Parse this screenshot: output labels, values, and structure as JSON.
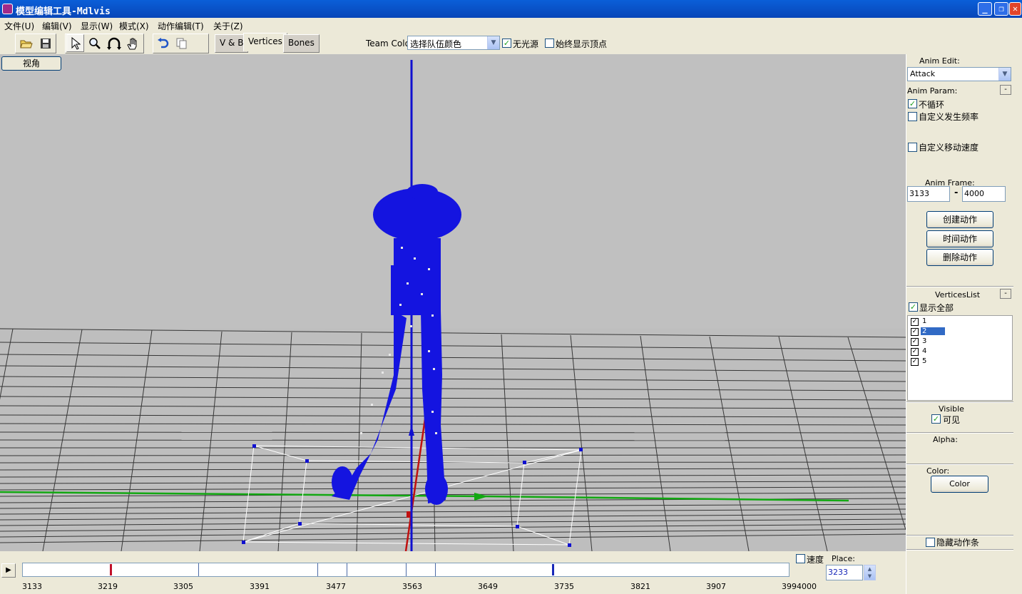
{
  "window": {
    "title": "模型编辑工具-Mdlvis",
    "minimize": "_",
    "restore": "❐",
    "close": "✕"
  },
  "menu": [
    {
      "label": "文件(U)"
    },
    {
      "label": "编辑(V)"
    },
    {
      "label": "显示(W)"
    },
    {
      "label": "模式(X)"
    },
    {
      "label": "动作编辑(T)"
    },
    {
      "label": "关于(Z)"
    }
  ],
  "toolbar": {
    "icons": [
      "open-icon",
      "save-icon",
      "select-arrow-icon",
      "zoom-icon",
      "rotate-icon",
      "pan-hand-icon",
      "undo-icon",
      "copy-icon"
    ],
    "tabs": [
      "V & B",
      "Vertices",
      "Bones"
    ],
    "active_tab": "Vertices",
    "team_color_label": "Team Color",
    "team_color_value": "选择队伍颜色",
    "no_light_label": "无光源",
    "no_light_checked": true,
    "always_show_vertices_label": "始终显示顶点",
    "always_show_vertices_checked": false
  },
  "viewport": {
    "view_button": "视角"
  },
  "right_panel": {
    "anim_edit_label": "Anim Edit:",
    "anim_edit_value": "Attack",
    "anim_param_label": "Anim Param:",
    "collapse": "-",
    "no_loop_label": "不循环",
    "no_loop_checked": true,
    "custom_rarity_label": "自定义发生频率",
    "custom_rarity_checked": false,
    "custom_move_speed_label": "自定义移动速度",
    "custom_move_speed_checked": false,
    "anim_frame_label": "Anim Frame:",
    "frame_start": "3133",
    "frame_dash": "-",
    "frame_end": "4000",
    "create_anim_button": "创建动作",
    "time_anim_button": "时间动作",
    "delete_anim_button": "删除动作",
    "vertices_list_label": "VerticesList",
    "show_all_label": "显示全部",
    "show_all_checked": true,
    "vertex_groups": [
      {
        "label": "1",
        "checked": true,
        "selected": false
      },
      {
        "label": "2",
        "checked": true,
        "selected": true
      },
      {
        "label": "3",
        "checked": true,
        "selected": false
      },
      {
        "label": "4",
        "checked": true,
        "selected": false
      },
      {
        "label": "5",
        "checked": true,
        "selected": false
      }
    ],
    "visible_label": "Visible",
    "visible_checkbox_label": "可见",
    "visible_checked": true,
    "alpha_label": "Alpha:",
    "color_label": "Color:",
    "color_button": "Color",
    "hide_anim_bar_label": "隐藏动作条",
    "hide_anim_bar_checked": false
  },
  "timeline": {
    "play": "▶",
    "tick_labels": [
      "3133",
      "3219",
      "3305",
      "3391",
      "3477",
      "3563",
      "3649",
      "3735",
      "3821",
      "3907",
      "3994000"
    ],
    "start": 3133,
    "end": 4000,
    "current_frame": 3233,
    "speed_label": "速度",
    "speed_checked": false,
    "place_label": "Place:",
    "place_value": "3233"
  }
}
